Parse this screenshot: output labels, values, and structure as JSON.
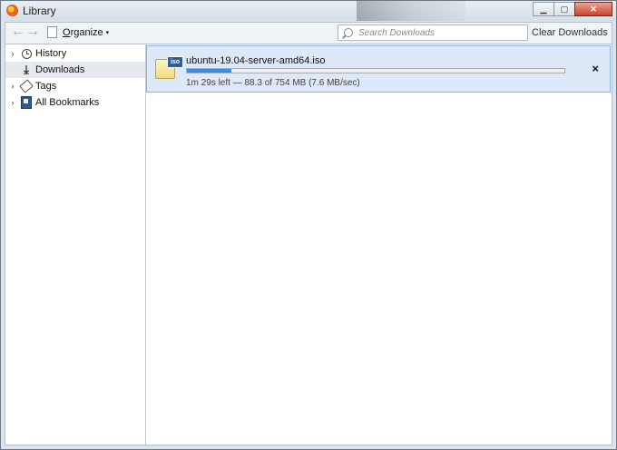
{
  "window": {
    "title": "Library",
    "controls": {
      "minimize": "▁",
      "maximize": "▢",
      "close": "✕"
    }
  },
  "toolbar": {
    "back": "←",
    "forward": "→",
    "organize_label": "Organize",
    "organize_caret": "▾",
    "search_placeholder": "Search Downloads",
    "search_value": "",
    "clear_label": "Clear Downloads"
  },
  "sidebar": {
    "items": [
      {
        "label": "History",
        "twisty": "›",
        "icon": "clock-icon",
        "selected": false
      },
      {
        "label": "Downloads",
        "twisty": "",
        "icon": "download-icon",
        "selected": true
      },
      {
        "label": "Tags",
        "twisty": "›",
        "icon": "tag-icon",
        "selected": false
      },
      {
        "label": "All Bookmarks",
        "twisty": "›",
        "icon": "bookmarks-icon",
        "selected": false
      }
    ]
  },
  "downloads": [
    {
      "file_name": "ubuntu-19.04-server-amd64.iso",
      "icon_badge": "iso",
      "progress_fraction": 0.117,
      "status": "1m 29s left — 88.3 of 754 MB (7.6 MB/sec)",
      "cancel": "×"
    }
  ],
  "colors": {
    "accent": "#3a8ee6",
    "selection": "#dde9f8",
    "selection_border": "#8cb4e6"
  }
}
